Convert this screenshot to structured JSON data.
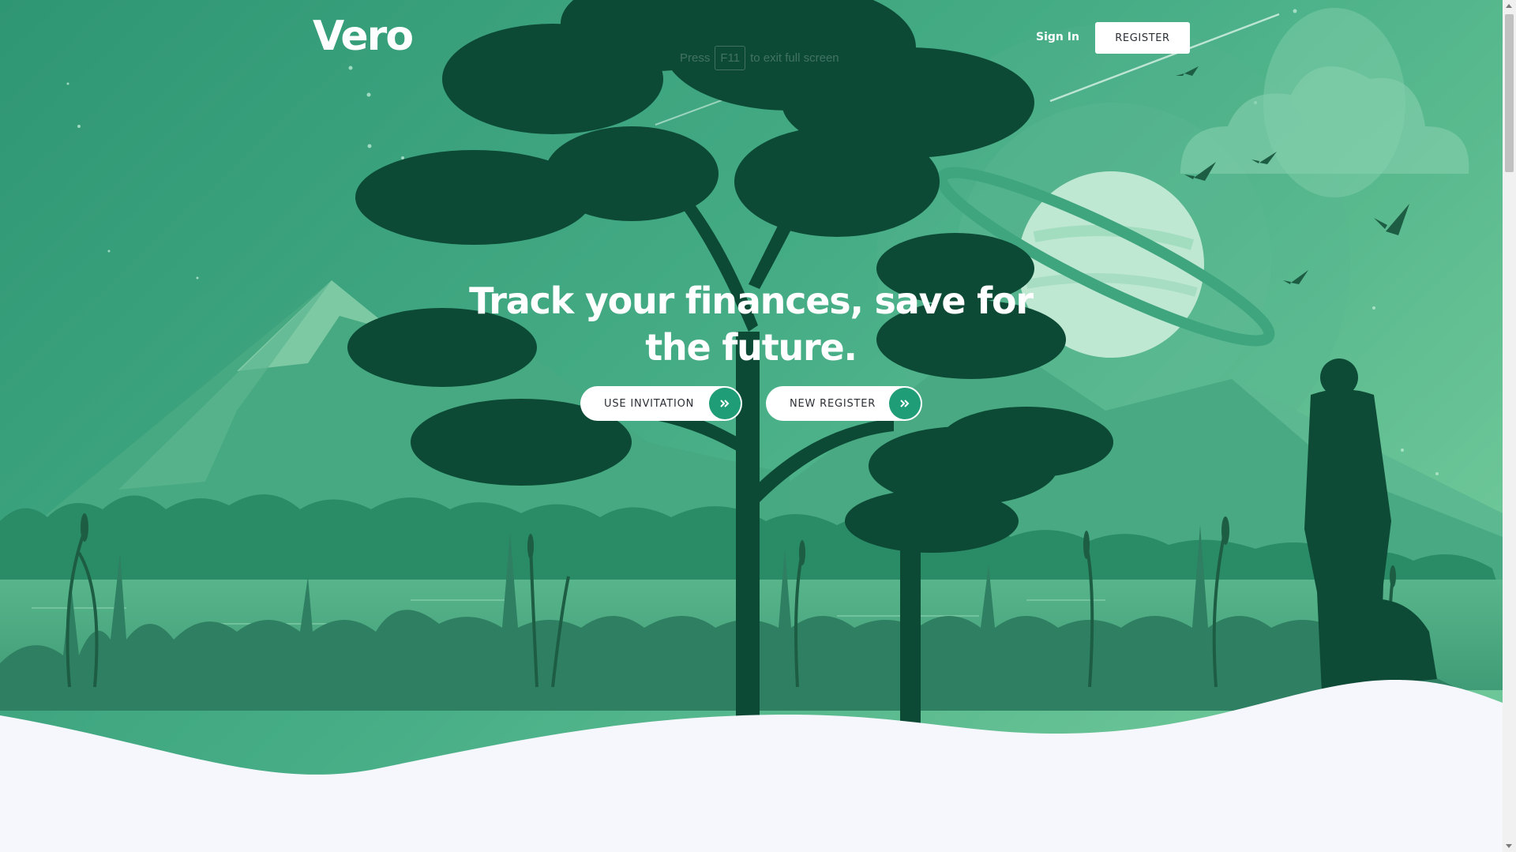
{
  "brand": {
    "logo_text": "Vero"
  },
  "overlay": {
    "prefix": "Press",
    "key": "F11",
    "suffix": "to exit full screen"
  },
  "nav": {
    "signin_label": "Sign In",
    "register_label": "REGISTER"
  },
  "hero": {
    "headline": "Track your finances, save for the future.",
    "buttons": [
      {
        "label": "USE INVITATION",
        "icon": "double-chevron-right-icon"
      },
      {
        "label": "NEW REGISTER",
        "icon": "double-chevron-right-icon"
      }
    ]
  },
  "colors": {
    "sky": "#3a9e7c",
    "accent": "#1f9d77",
    "tree": "#0c4a36",
    "page_bg": "#f6f7fc"
  }
}
